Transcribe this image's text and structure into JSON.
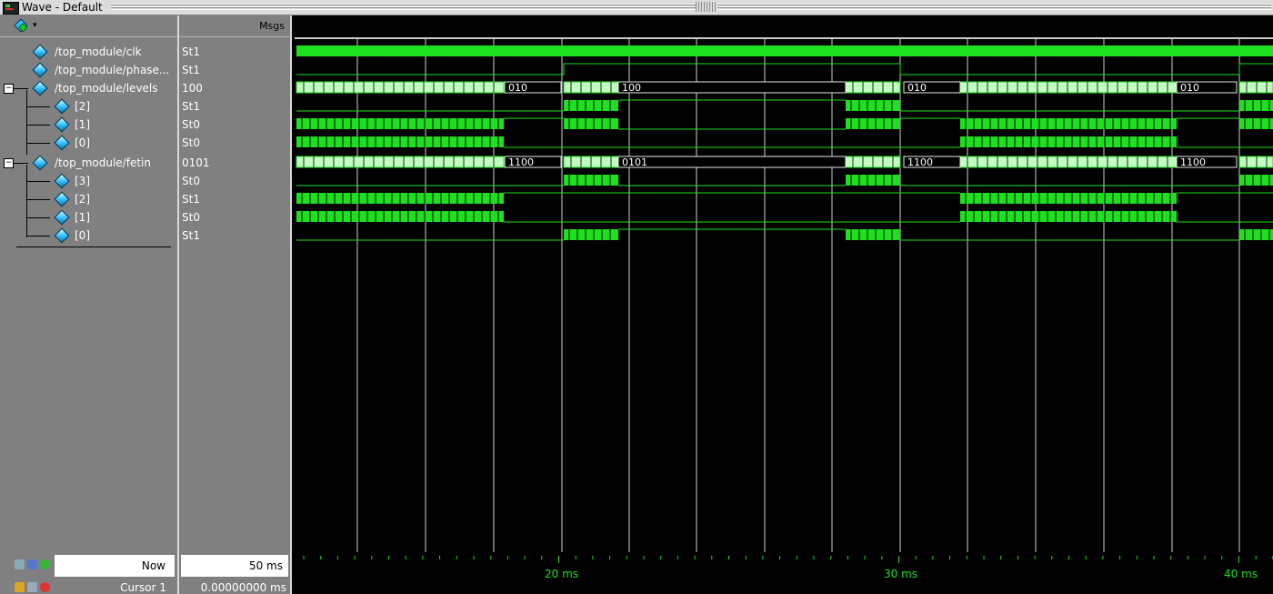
{
  "window": {
    "title": "Wave - Default"
  },
  "headers": {
    "msgs": "Msgs"
  },
  "signals": [
    {
      "label": "/top_module/clk",
      "value": "St1"
    },
    {
      "label": "/top_module/phase...",
      "value": "St1"
    },
    {
      "label": "/top_module/levels",
      "value": "100"
    },
    {
      "label": "[2]",
      "value": "St1"
    },
    {
      "label": "[1]",
      "value": "St0"
    },
    {
      "label": "[0]",
      "value": "St0"
    },
    {
      "label": "/top_module/fetin",
      "value": "0101"
    },
    {
      "label": "[3]",
      "value": "St0"
    },
    {
      "label": "[2]",
      "value": "St1"
    },
    {
      "label": "[1]",
      "value": "St0"
    },
    {
      "label": "[0]",
      "value": "St1"
    }
  ],
  "bus_labels": {
    "levels": [
      "010",
      "100",
      "010",
      "010"
    ],
    "fetin": [
      "1100",
      "0101",
      "1100",
      "1100"
    ]
  },
  "bottom": {
    "now_label": "Now",
    "now_value": "50 ms",
    "cursor_label": "Cursor 1",
    "cursor_value": "0.00000000 ms"
  },
  "ruler_labels": [
    "20 ms",
    "30 ms",
    "40 ms"
  ],
  "colors": {
    "wave": "#1ee01e",
    "wave_light": "#bfffbf",
    "background": "#000000",
    "pane": "#808080",
    "grid": "#d0d0d0"
  },
  "icons": [
    "wave-window-icon",
    "signal-diamond-icon",
    "expand-minus-icon",
    "add-icon",
    "lock-icon",
    "remove-icon"
  ]
}
